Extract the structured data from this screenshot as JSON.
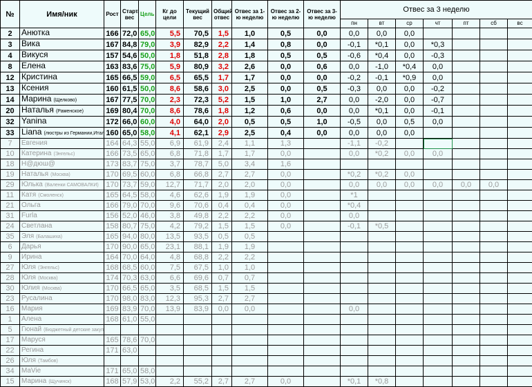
{
  "header": {
    "no": "№",
    "name": "Имя/ник",
    "height": "Рост",
    "start": "Старт. вес",
    "goal": "Цель",
    "togo": "Кг до цели",
    "current": "Текущий вес",
    "total": "Общий отвес",
    "w1": "Отвес за 1-ю неделю",
    "w2": "Отвес за 2-ю неделю",
    "w3": "Отвес за 3-ю неделю",
    "week3": "Отвес за 3 неделю",
    "days": [
      "пн",
      "вт",
      "ср",
      "чт",
      "пт",
      "сб",
      "вс"
    ]
  },
  "rows": [
    {
      "no": "2",
      "name": "Анютка",
      "sub": "",
      "h": "166",
      "s": "72,0",
      "g": "65,0",
      "t": "5,5",
      "c": "70,5",
      "o": "1,5",
      "w1": "1,0",
      "w2": "0,5",
      "w3": "0,0",
      "d": [
        "0,0",
        "0,0",
        "0,0",
        "",
        "",
        "",
        ""
      ],
      "a": true
    },
    {
      "no": "3",
      "name": "Вика",
      "sub": "",
      "h": "167",
      "s": "84,8",
      "g": "79,0",
      "t": "3,9",
      "c": "82,9",
      "o": "2,2",
      "w1": "1,4",
      "w2": "0,8",
      "w3": "0,0",
      "d": [
        "-0,1",
        "*0,1",
        "0,0",
        "*0,3",
        "",
        "",
        ""
      ],
      "a": true
    },
    {
      "no": "4",
      "name": "Викуся",
      "sub": "",
      "h": "157",
      "s": "54,6",
      "g": "50,0",
      "t": "1,8",
      "c": "51,8",
      "o": "2,8",
      "w1": "1,8",
      "w2": "0,5",
      "w3": "0,5",
      "d": [
        "-0,6",
        "*0,4",
        "0,0",
        "-0,3",
        "",
        "",
        ""
      ],
      "a": true
    },
    {
      "no": "8",
      "name": "Елена",
      "sub": "",
      "h": "163",
      "s": "83,6",
      "g": "75,0",
      "t": "5,9",
      "c": "80,9",
      "o": "3,2",
      "w1": "2,6",
      "w2": "0,0",
      "w3": "0,6",
      "d": [
        "0,0",
        "-1,0",
        "*0,4",
        "0,0",
        "",
        "",
        ""
      ],
      "a": true
    },
    {
      "no": "12",
      "name": "Кристина",
      "sub": "",
      "h": "165",
      "s": "66,5",
      "g": "59,0",
      "t": "6,5",
      "c": "65,5",
      "o": "1,7",
      "w1": "1,7",
      "w2": "0,0",
      "w3": "0,0",
      "d": [
        "-0,2",
        "-0,1",
        "*0,9",
        "0,0",
        "",
        "",
        ""
      ],
      "a": true
    },
    {
      "no": "13",
      "name": "Ксения",
      "sub": "",
      "h": "160",
      "s": "61,5",
      "g": "50,0",
      "t": "8,6",
      "c": "58,6",
      "o": "3,0",
      "w1": "2,5",
      "w2": "0,0",
      "w3": "0,5",
      "d": [
        "-0,3",
        "0,0",
        "0,0",
        "-0,2",
        "",
        "",
        ""
      ],
      "a": true
    },
    {
      "no": "14",
      "name": "Марина",
      "sub": "(Щелково)",
      "h": "167",
      "s": "77,5",
      "g": "70,0",
      "t": "2,3",
      "c": "72,3",
      "o": "5,2",
      "w1": "1,5",
      "w2": "1,0",
      "w3": "2,7",
      "d": [
        "0,0",
        "-2,0",
        "0,0",
        "-0,7",
        "",
        "",
        ""
      ],
      "a": true
    },
    {
      "no": "20",
      "name": "Наталья",
      "sub": "(Раменское)",
      "h": "169",
      "s": "80,4",
      "g": "70,0",
      "t": "8,6",
      "c": "78,6",
      "o": "1,8",
      "w1": "1,2",
      "w2": "0,6",
      "w3": "0,0",
      "d": [
        "0,0",
        "*0,1",
        "0,0",
        "-0,1",
        "",
        "",
        ""
      ],
      "a": true
    },
    {
      "no": "32",
      "name": "Yanina",
      "sub": "",
      "h": "172",
      "s": "66,0",
      "g": "60,0",
      "t": "4,0",
      "c": "64,0",
      "o": "2,0",
      "w1": "0,5",
      "w2": "0,5",
      "w3": "1,0",
      "d": [
        "-0,5",
        "0,0",
        "0,5",
        "0,0",
        "",
        "",
        ""
      ],
      "a": true
    },
    {
      "no": "33",
      "name": "Liana",
      "sub": "(люстры из Германии,Итали)",
      "h": "160",
      "s": "65,0",
      "g": "58,0",
      "t": "4,1",
      "c": "62,1",
      "o": "2,9",
      "w1": "2,5",
      "w2": "0,4",
      "w3": "0,0",
      "d": [
        "0,0",
        "0,0",
        "0,0",
        "",
        "",
        "",
        ""
      ],
      "a": true
    },
    {
      "no": "7",
      "name": "Евгения",
      "sub": "",
      "h": "164",
      "s": "64,3",
      "s2": "",
      "g": "55,0",
      "t": "6,9",
      "c": "61,9",
      "o": "2,4",
      "w1": "1,1",
      "w2": "1,3",
      "w3": "",
      "d": [
        "-1,1",
        "-0,2",
        "",
        "",
        "",
        "",
        ""
      ],
      "a": false
    },
    {
      "no": "10",
      "name": "Катерина",
      "sub": "(Энгельс)",
      "h": "166",
      "s": "73,5",
      "g": "65,0",
      "t": "6,8",
      "c": "71,8",
      "o": "1,7",
      "w1": "1,7",
      "w2": "0,0",
      "w3": "",
      "d": [
        "0,0",
        "*0,2",
        "0,0",
        "0,0",
        "",
        "",
        ""
      ],
      "a": false
    },
    {
      "no": "18",
      "name": "Н@дюш@",
      "sub": "",
      "h": "173",
      "s": "83,7",
      "g": "75,0",
      "t": "3,7",
      "c": "78,7",
      "o": "5,0",
      "w1": "3,4",
      "w2": "1,6",
      "w3": "",
      "d": [
        "",
        "",
        "",
        "",
        "",
        "",
        ""
      ],
      "a": false
    },
    {
      "no": "19",
      "name": "Наталья",
      "sub": "(Москва)",
      "h": "170",
      "s": "69,5",
      "g": "60,0",
      "t": "6,8",
      "c": "66,8",
      "o": "2,7",
      "w1": "2,7",
      "w2": "0,0",
      "w3": "",
      "d": [
        "*0,2",
        "*0,2",
        "0,0",
        "",
        "",
        "",
        ""
      ],
      "a": false
    },
    {
      "no": "29",
      "name": "Юлька",
      "sub": "(Валенки САМОВАЛКИ)",
      "h": "170",
      "s": "73,7",
      "g": "59,0",
      "t": "12,7",
      "c": "71,7",
      "o": "2,0",
      "w1": "2,0",
      "w2": "0,0",
      "w3": "",
      "d": [
        "0,0",
        "0,0",
        "0,0",
        "0,0",
        "0,0",
        "0,0",
        ""
      ],
      "a": false
    },
    {
      "no": "11",
      "name": "Катя",
      "sub": "(Смоленск)",
      "h": "165",
      "s": "64,5",
      "g": "58,0",
      "t": "4,6",
      "c": "62,6",
      "o": "1,9",
      "w1": "1,9",
      "w2": "0,0",
      "w3": "",
      "d": [
        "*1",
        "",
        "",
        "",
        "",
        "",
        ""
      ],
      "a": false
    },
    {
      "no": "21",
      "name": "Ольга",
      "sub": "",
      "h": "166",
      "s": "79,0",
      "g": "70,0",
      "t": "9,6",
      "c": "70,6",
      "o": "0,4",
      "w1": "0,4",
      "w2": "0,0",
      "w3": "",
      "d": [
        "*0,4",
        "",
        "",
        "",
        "",
        "",
        ""
      ],
      "a": false
    },
    {
      "no": "31",
      "name": "Furla",
      "sub": "",
      "h": "156",
      "s": "52,0",
      "g": "46,0",
      "t": "3,8",
      "c": "49,8",
      "o": "2,2",
      "w1": "2,2",
      "w2": "0,0",
      "w3": "",
      "d": [
        "0,0",
        "",
        "",
        "",
        "",
        "",
        ""
      ],
      "a": false
    },
    {
      "no": "24",
      "name": "Светлана",
      "sub": "",
      "h": "158",
      "s": "80,7",
      "g": "75,0",
      "t": "4,2",
      "c": "79,2",
      "o": "1,5",
      "w1": "1,5",
      "w2": "0,0",
      "w3": "",
      "d": [
        "-0,1",
        "*0,5",
        "",
        "",
        "",
        "",
        ""
      ],
      "a": false
    },
    {
      "no": "35",
      "name": "Эля",
      "sub": "(Балашиха)",
      "h": "165",
      "s": "94,0",
      "g": "80,0",
      "t": "13,5",
      "c": "93,5",
      "o": "0,5",
      "w1": "0,5",
      "w2": "",
      "w3": "",
      "d": [
        "",
        "",
        "",
        "",
        "",
        "",
        ""
      ],
      "a": false
    },
    {
      "no": "6",
      "name": "Дарья",
      "sub": "",
      "h": "170",
      "s": "90,0",
      "g": "65,0",
      "t": "23,1",
      "c": "88,1",
      "o": "1,9",
      "w1": "1,9",
      "w2": "",
      "w3": "",
      "d": [
        "",
        "",
        "",
        "",
        "",
        "",
        ""
      ],
      "a": false
    },
    {
      "no": "9",
      "name": "Ирина",
      "sub": "",
      "h": "164",
      "s": "70,0",
      "g": "64,0",
      "t": "4,8",
      "c": "68,8",
      "o": "2,2",
      "w1": "2,2",
      "w2": "",
      "w3": "",
      "d": [
        "",
        "",
        "",
        "",
        "",
        "",
        ""
      ],
      "a": false
    },
    {
      "no": "27",
      "name": "Юля",
      "sub": "(Энгельс)",
      "h": "168",
      "s": "68,5",
      "g": "60,0",
      "t": "7,5",
      "c": "67,5",
      "o": "1,0",
      "w1": "1,0",
      "w2": "",
      "w3": "",
      "d": [
        "",
        "",
        "",
        "",
        "",
        "",
        ""
      ],
      "a": false
    },
    {
      "no": "28",
      "name": "Юля",
      "sub": "(Москва)",
      "h": "174",
      "s": "70,3",
      "g": "63,0",
      "t": "6,6",
      "c": "69,6",
      "o": "0,7",
      "w1": "0,7",
      "w2": "",
      "w3": "",
      "d": [
        "",
        "",
        "",
        "",
        "",
        "",
        ""
      ],
      "a": false
    },
    {
      "no": "30",
      "name": "Юлия",
      "sub": "(Москва)",
      "h": "170",
      "s": "66,5",
      "g": "65,0",
      "t": "3,5",
      "c": "68,5",
      "o": "1,5",
      "w1": "1,5",
      "w2": "",
      "w3": "",
      "d": [
        "",
        "",
        "",
        "",
        "",
        "",
        ""
      ],
      "a": false
    },
    {
      "no": "23",
      "name": "Русалина",
      "sub": "",
      "h": "170",
      "s": "98,0",
      "g": "83,0",
      "t": "12,3",
      "c": "95,3",
      "o": "2,7",
      "w1": "2,7",
      "w2": "",
      "w3": "",
      "d": [
        "",
        "",
        "",
        "",
        "",
        "",
        ""
      ],
      "a": false
    },
    {
      "no": "16",
      "name": "Мария",
      "sub": "",
      "h": "169",
      "s": "83,9",
      "g": "70,0",
      "t": "13,9",
      "c": "83,9",
      "o": "0,0",
      "w1": "0,0",
      "w2": "",
      "w3": "",
      "d": [
        "0,0",
        "",
        "",
        "",
        "",
        "",
        ""
      ],
      "a": false
    },
    {
      "no": "1",
      "name": "Алена",
      "sub": "",
      "h": "168",
      "s": "61,0",
      "g": "55,0",
      "t": "",
      "c": "",
      "o": "",
      "w1": "",
      "w2": "",
      "w3": "",
      "d": [
        "",
        "",
        "",
        "",
        "",
        "",
        ""
      ],
      "a": false
    },
    {
      "no": "5",
      "name": "Гюнай",
      "sub": "(Бюджетный детские закупки)",
      "h": "",
      "s": "",
      "g": "",
      "t": "",
      "c": "",
      "o": "",
      "w1": "",
      "w2": "",
      "w3": "",
      "d": [
        "",
        "",
        "",
        "",
        "",
        "",
        ""
      ],
      "a": false
    },
    {
      "no": "17",
      "name": "Маруся",
      "sub": "",
      "h": "165",
      "s": "78,6",
      "g": "70,0",
      "t": "",
      "c": "",
      "o": "",
      "w1": "",
      "w2": "",
      "w3": "",
      "d": [
        "",
        "",
        "",
        "",
        "",
        "",
        ""
      ],
      "a": false
    },
    {
      "no": "22",
      "name": "Регина",
      "sub": "",
      "h": "171",
      "s": "63,0",
      "g": "",
      "t": "",
      "c": "",
      "o": "",
      "w1": "",
      "w2": "",
      "w3": "",
      "d": [
        "",
        "",
        "",
        "",
        "",
        "",
        ""
      ],
      "a": false
    },
    {
      "no": "26",
      "name": "Юля",
      "sub": "(Тамбов)",
      "h": "",
      "s": "",
      "g": "",
      "t": "",
      "c": "",
      "o": "",
      "w1": "",
      "w2": "",
      "w3": "",
      "d": [
        "",
        "",
        "",
        "",
        "",
        "",
        ""
      ],
      "a": false
    },
    {
      "no": "34",
      "name": "MaVie",
      "sub": "",
      "h": "171",
      "s": "65,0",
      "g": "58,0",
      "t": "",
      "c": "",
      "o": "",
      "w1": "",
      "w2": "",
      "w3": "",
      "d": [
        "",
        "",
        "",
        "",
        "",
        "",
        ""
      ],
      "a": false
    },
    {
      "no": "15",
      "name": "Марина",
      "sub": "(Щучинск)",
      "h": "168",
      "s": "57,9",
      "g": "53,0",
      "t": "2,2",
      "c": "55,2",
      "o": "2,7",
      "w1": "2,7",
      "w2": "0,0",
      "w3": "",
      "d": [
        "*0,1",
        "*0,8",
        "",
        "",
        "",
        "",
        ""
      ],
      "a": false
    }
  ]
}
